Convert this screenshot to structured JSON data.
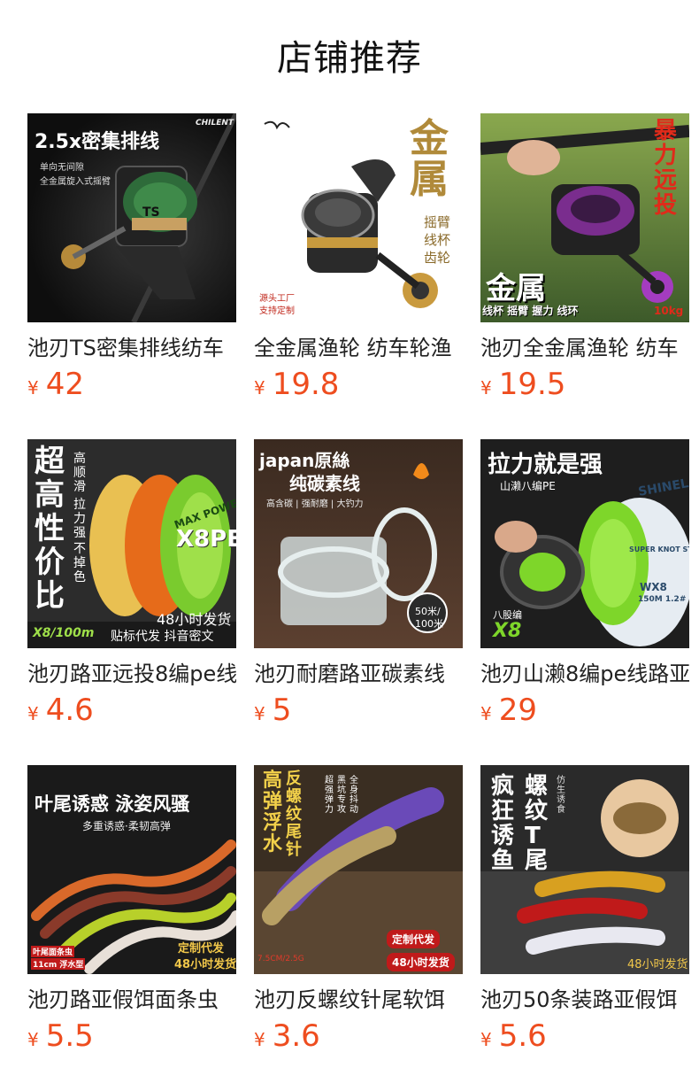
{
  "title": "店铺推荐",
  "currency_symbol": "¥",
  "colors": {
    "price": "#ee4d1f",
    "title": "#111111",
    "text": "#222222"
  },
  "products": [
    {
      "name": "池刃TS密集排线纺车",
      "price": "42",
      "image": {
        "icon": "spinning-reel-icon",
        "overlay": [
          "2.5x密集排线",
          "单向无间隙",
          "全金属旋入式摇臂",
          "CHILENT",
          "TS"
        ]
      }
    },
    {
      "name": "全金属渔轮 纺车轮渔",
      "price": "19.8",
      "image": {
        "icon": "spinning-reel-icon",
        "overlay": [
          "金属",
          "摇臂",
          "线杯",
          "齿轮",
          "源头工厂",
          "支持定制"
        ]
      }
    },
    {
      "name": "池刃全金属渔轮 纺车",
      "price": "19.5",
      "image": {
        "icon": "spinning-reel-icon",
        "overlay": [
          "暴力远投",
          "金属",
          "线杯 摇臂 握力 线环",
          "10kg"
        ]
      }
    },
    {
      "name": "池刃路亚远投8编pe线",
      "price": "4.6",
      "image": {
        "icon": "line-spool-icon",
        "overlay": [
          "超高性价比",
          "高顺滑",
          "拉力强",
          "不掉色",
          "MAX POWER",
          "X8PE",
          "48小时发货",
          "X8/100m",
          "贴标代发 抖音密文"
        ]
      }
    },
    {
      "name": "池刃耐磨路亚碳素线",
      "price": "5",
      "image": {
        "icon": "line-spool-icon",
        "overlay": [
          "japan原絲",
          "纯碳素线",
          "高含碳 | 强耐磨 | 大钓力",
          "50米/",
          "100米"
        ]
      }
    },
    {
      "name": "池刃山濑8编pe线路亚",
      "price": "29",
      "image": {
        "icon": "line-spool-icon",
        "overlay": [
          "拉力就是强",
          "山濑八编PE",
          "SHINELA",
          "SUPER KNOT STRENGTH",
          "WX8",
          "150M 1.2#",
          "八股编",
          "X8"
        ]
      }
    },
    {
      "name": "池刃路亚假饵面条虫",
      "price": "5.5",
      "image": {
        "icon": "soft-worm-lure-icon",
        "overlay": [
          "叶尾诱惑 泳姿风骚",
          "多重诱惑·柔韧高弹",
          "叶尾面条虫",
          "11cm 浮水型",
          "定制代发",
          "48小时发货"
        ]
      }
    },
    {
      "name": "池刃反螺纹针尾软饵",
      "price": "3.6",
      "image": {
        "icon": "soft-worm-lure-icon",
        "overlay": [
          "高弹浮水",
          "反螺纹尾针",
          "超强弹力",
          "黑坑专攻",
          "全身抖动",
          "7.5CM/2.5G",
          "定制代发",
          "48小时发货"
        ]
      }
    },
    {
      "name": "池刃50条装路亚假饵",
      "price": "5.6",
      "image": {
        "icon": "t-tail-lure-icon",
        "overlay": [
          "疯狂诱鱼",
          "螺纹T尾",
          "仿生诱食",
          "48小时发货"
        ]
      }
    }
  ]
}
